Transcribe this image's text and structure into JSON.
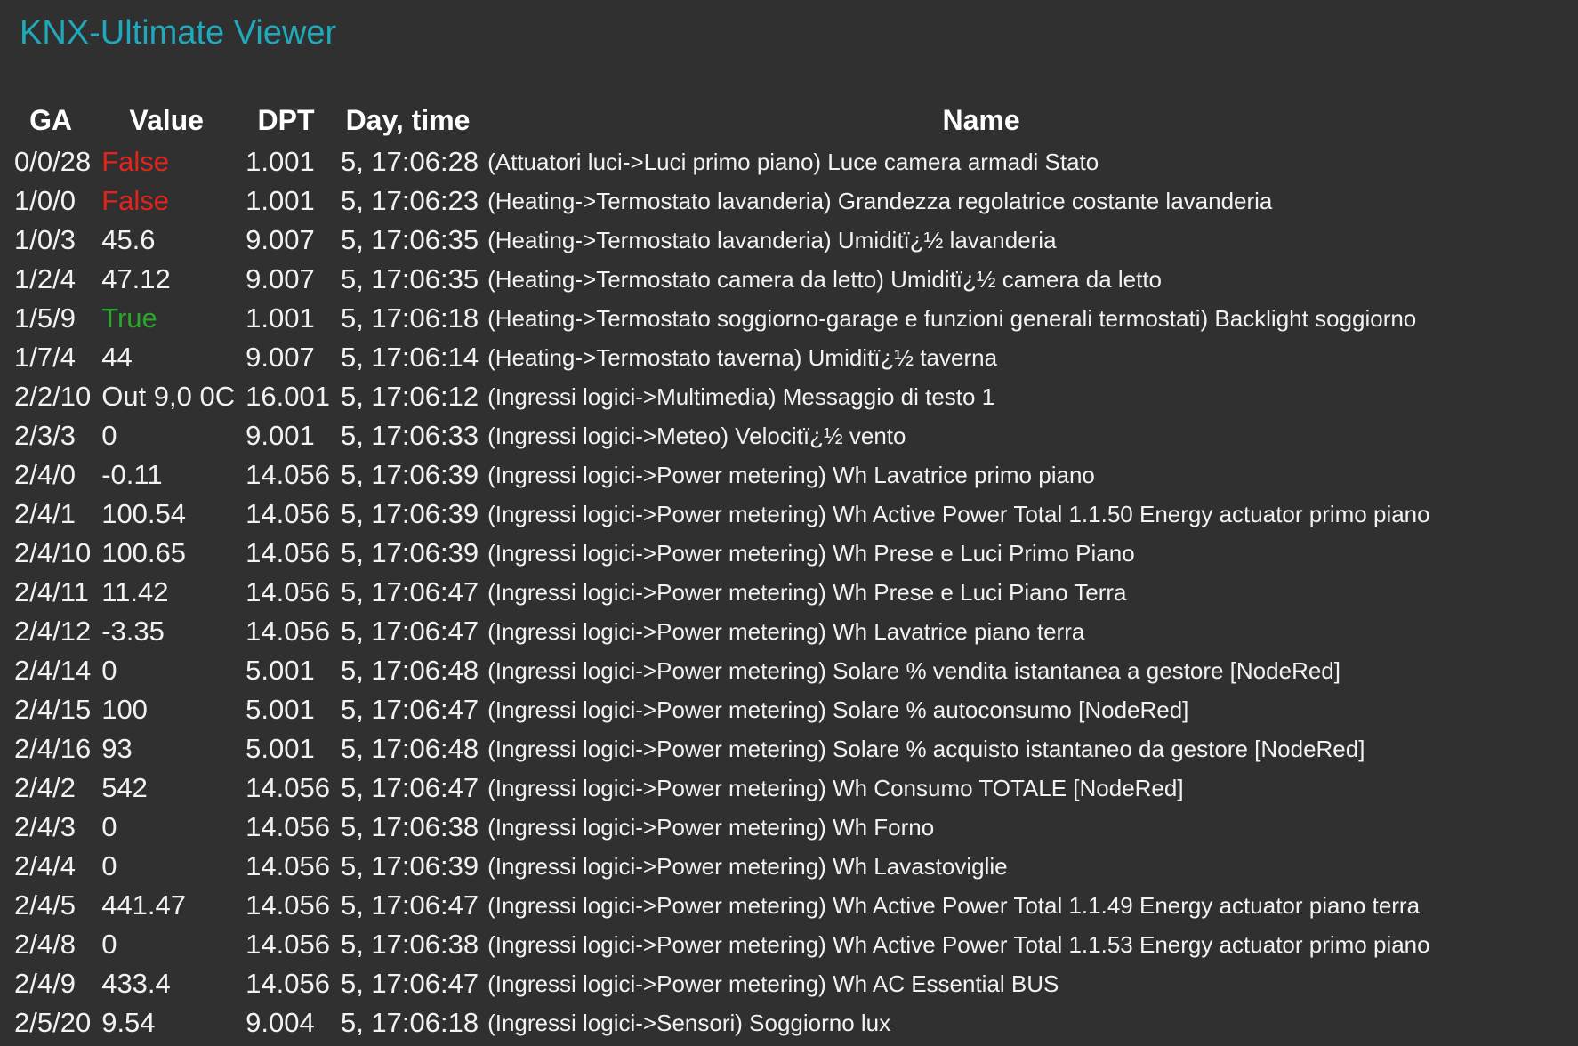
{
  "app": {
    "title": "KNX-Ultimate Viewer"
  },
  "table": {
    "headers": {
      "ga": "GA",
      "value": "Value",
      "dpt": "DPT",
      "time": "Day, time",
      "name": "Name"
    },
    "colors": {
      "title": "#1fa9bb",
      "false": "#e3241d",
      "true": "#2ba52b",
      "text": "#f2f2f2",
      "background": "#303030"
    },
    "rows": [
      {
        "ga": "0/0/28",
        "value": "False",
        "kind": "false",
        "dpt": "1.001",
        "time": "5, 17:06:28",
        "name": "(Attuatori luci->Luci primo piano) Luce camera armadi Stato"
      },
      {
        "ga": "1/0/0",
        "value": "False",
        "kind": "false",
        "dpt": "1.001",
        "time": "5, 17:06:23",
        "name": "(Heating->Termostato lavanderia) Grandezza regolatrice costante lavanderia"
      },
      {
        "ga": "1/0/3",
        "value": "45.6",
        "kind": "plain",
        "dpt": "9.007",
        "time": "5, 17:06:35",
        "name": "(Heating->Termostato lavanderia) Umiditï¿½ lavanderia"
      },
      {
        "ga": "1/2/4",
        "value": "47.12",
        "kind": "plain",
        "dpt": "9.007",
        "time": "5, 17:06:35",
        "name": "(Heating->Termostato camera da letto) Umiditï¿½ camera da letto"
      },
      {
        "ga": "1/5/9",
        "value": "True",
        "kind": "true",
        "dpt": "1.001",
        "time": "5, 17:06:18",
        "name": "(Heating->Termostato soggiorno-garage e funzioni generali termostati) Backlight soggiorno"
      },
      {
        "ga": "1/7/4",
        "value": "44",
        "kind": "plain",
        "dpt": "9.007",
        "time": "5, 17:06:14",
        "name": "(Heating->Termostato taverna) Umiditï¿½ taverna"
      },
      {
        "ga": "2/2/10",
        "value": "Out 9,0 0C",
        "kind": "plain",
        "dpt": "16.001",
        "time": "5, 17:06:12",
        "name": "(Ingressi logici->Multimedia) Messaggio di testo 1"
      },
      {
        "ga": "2/3/3",
        "value": "0",
        "kind": "plain",
        "dpt": "9.001",
        "time": "5, 17:06:33",
        "name": "(Ingressi logici->Meteo) Velocitï¿½ vento"
      },
      {
        "ga": "2/4/0",
        "value": "-0.11",
        "kind": "plain",
        "dpt": "14.056",
        "time": "5, 17:06:39",
        "name": "(Ingressi logici->Power metering) Wh Lavatrice primo piano"
      },
      {
        "ga": "2/4/1",
        "value": "100.54",
        "kind": "plain",
        "dpt": "14.056",
        "time": "5, 17:06:39",
        "name": "(Ingressi logici->Power metering) Wh Active Power Total 1.1.50 Energy actuator primo piano"
      },
      {
        "ga": "2/4/10",
        "value": "100.65",
        "kind": "plain",
        "dpt": "14.056",
        "time": "5, 17:06:39",
        "name": "(Ingressi logici->Power metering) Wh Prese e Luci Primo Piano"
      },
      {
        "ga": "2/4/11",
        "value": "11.42",
        "kind": "plain",
        "dpt": "14.056",
        "time": "5, 17:06:47",
        "name": "(Ingressi logici->Power metering) Wh Prese e Luci Piano Terra"
      },
      {
        "ga": "2/4/12",
        "value": "-3.35",
        "kind": "plain",
        "dpt": "14.056",
        "time": "5, 17:06:47",
        "name": "(Ingressi logici->Power metering) Wh Lavatrice piano terra"
      },
      {
        "ga": "2/4/14",
        "value": "0",
        "kind": "plain",
        "dpt": "5.001",
        "time": "5, 17:06:48",
        "name": "(Ingressi logici->Power metering) Solare % vendita istantanea a gestore [NodeRed]"
      },
      {
        "ga": "2/4/15",
        "value": "100",
        "kind": "plain",
        "dpt": "5.001",
        "time": "5, 17:06:47",
        "name": "(Ingressi logici->Power metering) Solare % autoconsumo [NodeRed]"
      },
      {
        "ga": "2/4/16",
        "value": "93",
        "kind": "plain",
        "dpt": "5.001",
        "time": "5, 17:06:48",
        "name": "(Ingressi logici->Power metering) Solare % acquisto istantaneo da gestore [NodeRed]"
      },
      {
        "ga": "2/4/2",
        "value": "542",
        "kind": "plain",
        "dpt": "14.056",
        "time": "5, 17:06:47",
        "name": "(Ingressi logici->Power metering) Wh Consumo TOTALE [NodeRed]"
      },
      {
        "ga": "2/4/3",
        "value": "0",
        "kind": "plain",
        "dpt": "14.056",
        "time": "5, 17:06:38",
        "name": "(Ingressi logici->Power metering) Wh Forno"
      },
      {
        "ga": "2/4/4",
        "value": "0",
        "kind": "plain",
        "dpt": "14.056",
        "time": "5, 17:06:39",
        "name": "(Ingressi logici->Power metering) Wh Lavastoviglie"
      },
      {
        "ga": "2/4/5",
        "value": "441.47",
        "kind": "plain",
        "dpt": "14.056",
        "time": "5, 17:06:47",
        "name": "(Ingressi logici->Power metering) Wh Active Power Total 1.1.49 Energy actuator piano terra"
      },
      {
        "ga": "2/4/8",
        "value": "0",
        "kind": "plain",
        "dpt": "14.056",
        "time": "5, 17:06:38",
        "name": "(Ingressi logici->Power metering) Wh Active Power Total 1.1.53 Energy actuator primo piano"
      },
      {
        "ga": "2/4/9",
        "value": "433.4",
        "kind": "plain",
        "dpt": "14.056",
        "time": "5, 17:06:47",
        "name": "(Ingressi logici->Power metering) Wh AC Essential BUS"
      },
      {
        "ga": "2/5/20",
        "value": "9.54",
        "kind": "plain",
        "dpt": "9.004",
        "time": "5, 17:06:18",
        "name": "(Ingressi logici->Sensori) Soggiorno lux"
      }
    ]
  }
}
